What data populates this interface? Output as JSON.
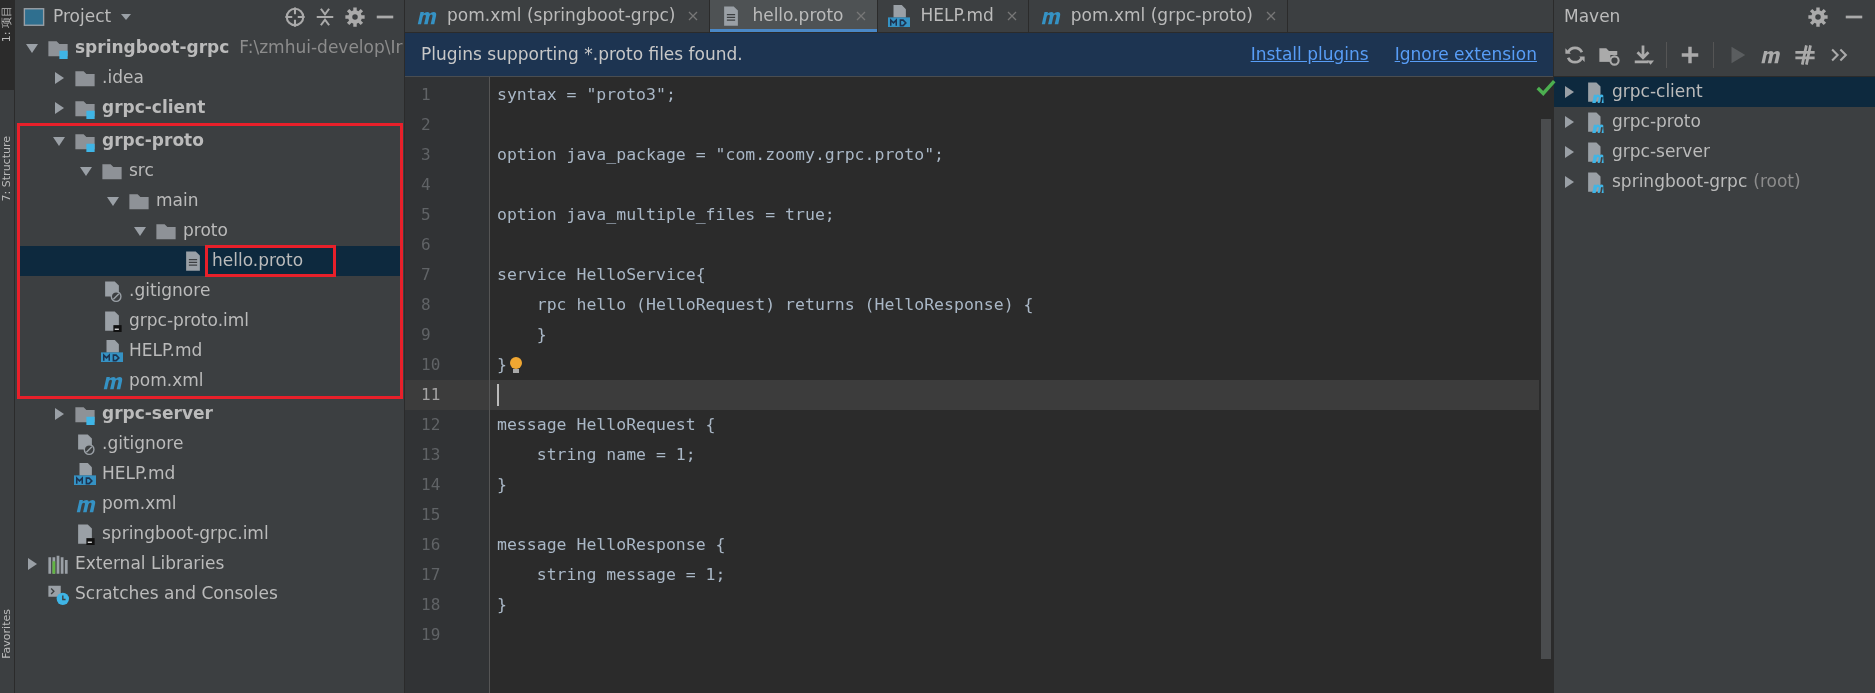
{
  "tool_stripe": [
    {
      "label": "1: 项目",
      "selected": true
    },
    {
      "label": "7: Structure",
      "selected": false
    },
    {
      "label": "Favorites",
      "selected": false
    }
  ],
  "project_panel": {
    "title": "Project",
    "tree": [
      {
        "label": "springboot-grpc",
        "hint": "F:\\zmhui-develop\\Ir",
        "kind": "module",
        "bold": true,
        "expanded": true,
        "selected": false,
        "children": [
          {
            "label": ".idea",
            "kind": "folder",
            "bold": false,
            "expanded": false,
            "selected": false
          },
          {
            "label": "grpc-client",
            "kind": "module",
            "bold": true,
            "expanded": false,
            "selected": false
          },
          {
            "label": "grpc-proto",
            "kind": "module",
            "bold": true,
            "expanded": true,
            "selected": false,
            "annotated": true,
            "children": [
              {
                "label": "src",
                "kind": "folder",
                "bold": false,
                "expanded": true,
                "selected": false,
                "children": [
                  {
                    "label": "main",
                    "kind": "folder",
                    "bold": false,
                    "expanded": true,
                    "selected": false,
                    "children": [
                      {
                        "label": "proto",
                        "kind": "folder",
                        "bold": false,
                        "expanded": true,
                        "selected": false,
                        "children": [
                          {
                            "label": "hello.proto",
                            "kind": "text",
                            "bold": false,
                            "selected": true,
                            "annotated": true
                          }
                        ]
                      }
                    ]
                  }
                ]
              },
              {
                "label": ".gitignore",
                "kind": "ignore",
                "bold": false,
                "selected": false
              },
              {
                "label": "grpc-proto.iml",
                "kind": "iml",
                "bold": false,
                "selected": false
              },
              {
                "label": "HELP.md",
                "kind": "md",
                "bold": false,
                "selected": false
              },
              {
                "label": "pom.xml",
                "kind": "maven",
                "bold": false,
                "selected": false
              }
            ]
          },
          {
            "label": "grpc-server",
            "kind": "module",
            "bold": true,
            "expanded": false,
            "selected": false
          },
          {
            "label": ".gitignore",
            "kind": "ignore",
            "bold": false,
            "selected": false
          },
          {
            "label": "HELP.md",
            "kind": "md",
            "bold": false,
            "selected": false
          },
          {
            "label": "pom.xml",
            "kind": "maven",
            "bold": false,
            "selected": false
          },
          {
            "label": "springboot-grpc.iml",
            "kind": "iml",
            "bold": false,
            "selected": false
          }
        ]
      },
      {
        "label": "External Libraries",
        "kind": "libraries",
        "bold": false,
        "expanded": false,
        "selected": false
      },
      {
        "label": "Scratches and Consoles",
        "kind": "scratches",
        "bold": false,
        "selected": false
      }
    ]
  },
  "editor": {
    "tabs": [
      {
        "label": "pom.xml (springboot-grpc)",
        "kind": "maven",
        "selected": false
      },
      {
        "label": "hello.proto",
        "kind": "text",
        "selected": true
      },
      {
        "label": "HELP.md",
        "kind": "md",
        "selected": false
      },
      {
        "label": "pom.xml (grpc-proto)",
        "kind": "maven",
        "selected": false
      }
    ],
    "notification": {
      "text": "Plugins supporting *.proto files found.",
      "actions": [
        "Install plugins",
        "Ignore extension"
      ]
    },
    "lines": [
      {
        "number": "1",
        "text": "syntax = \"proto3\";",
        "current": false
      },
      {
        "number": "2",
        "current": false
      },
      {
        "number": "3",
        "text": "option java_package = \"com.zoomy.grpc.proto\";",
        "current": false
      },
      {
        "number": "4",
        "current": false
      },
      {
        "number": "5",
        "text": "option java_multiple_files = true;",
        "current": false
      },
      {
        "number": "6",
        "current": false
      },
      {
        "number": "7",
        "text": "service HelloService{",
        "current": false
      },
      {
        "number": "8",
        "text": "    rpc hello (HelloRequest) returns (HelloResponse) {",
        "current": false
      },
      {
        "number": "9",
        "text": "    }",
        "current": false
      },
      {
        "number": "10",
        "text": "}",
        "current": false,
        "bulb": true
      },
      {
        "number": "11",
        "current": true
      },
      {
        "number": "12",
        "text": "message HelloRequest {",
        "current": false
      },
      {
        "number": "13",
        "text": "    string name = 1;",
        "current": false
      },
      {
        "number": "14",
        "text": "}",
        "current": false
      },
      {
        "number": "15",
        "current": false
      },
      {
        "number": "16",
        "text": "message HelloResponse {",
        "current": false
      },
      {
        "number": "17",
        "text": "    string message = 1;",
        "current": false
      },
      {
        "number": "18",
        "text": "}",
        "current": false
      },
      {
        "number": "19",
        "current": false
      }
    ]
  },
  "maven": {
    "title": "Maven",
    "projects": [
      {
        "label": "grpc-client",
        "selected": true
      },
      {
        "label": "grpc-proto",
        "selected": false
      },
      {
        "label": "grpc-server",
        "selected": false
      },
      {
        "label": "springboot-grpc",
        "hint": "(root)",
        "selected": false
      }
    ]
  }
}
